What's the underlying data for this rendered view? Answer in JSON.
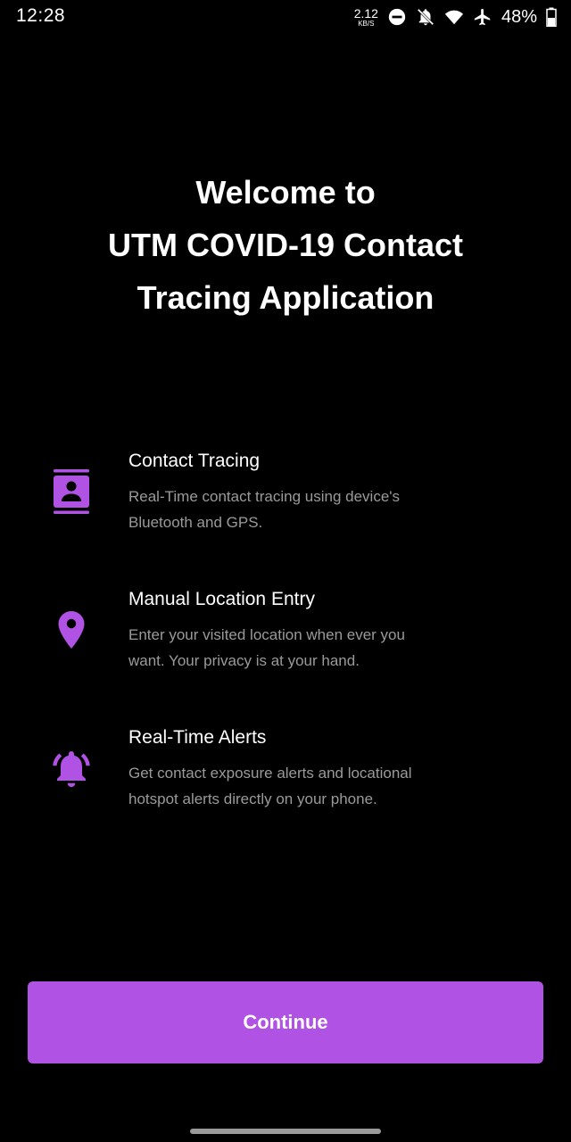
{
  "status_bar": {
    "time": "12:28",
    "net_speed_value": "2.12",
    "net_speed_unit": "KB/S",
    "battery": "48%",
    "icons": [
      "dnd-icon",
      "notifications-off-icon",
      "wifi-icon",
      "airplane-icon",
      "battery-icon"
    ]
  },
  "welcome": {
    "line1": "Welcome to",
    "line2": "UTM COVID-19 Contact",
    "line3": "Tracing Application"
  },
  "features": [
    {
      "icon": "contact-card-icon",
      "title": "Contact Tracing",
      "desc_line1": "Real-Time contact tracing using device's",
      "desc_line2": "Bluetooth and GPS."
    },
    {
      "icon": "location-pin-icon",
      "title": "Manual Location Entry",
      "desc_line1": "Enter your visited location when ever you",
      "desc_line2": "want. Your privacy is at your hand."
    },
    {
      "icon": "alert-bell-icon",
      "title": "Real-Time Alerts",
      "desc_line1": "Get contact exposure alerts and locational",
      "desc_line2": "hotspot alerts directly on your phone."
    }
  ],
  "continue_label": "Continue",
  "colors": {
    "accent": "#b052e3",
    "background": "#000000",
    "text_primary": "#ffffff",
    "text_secondary": "#9a9a9a"
  }
}
